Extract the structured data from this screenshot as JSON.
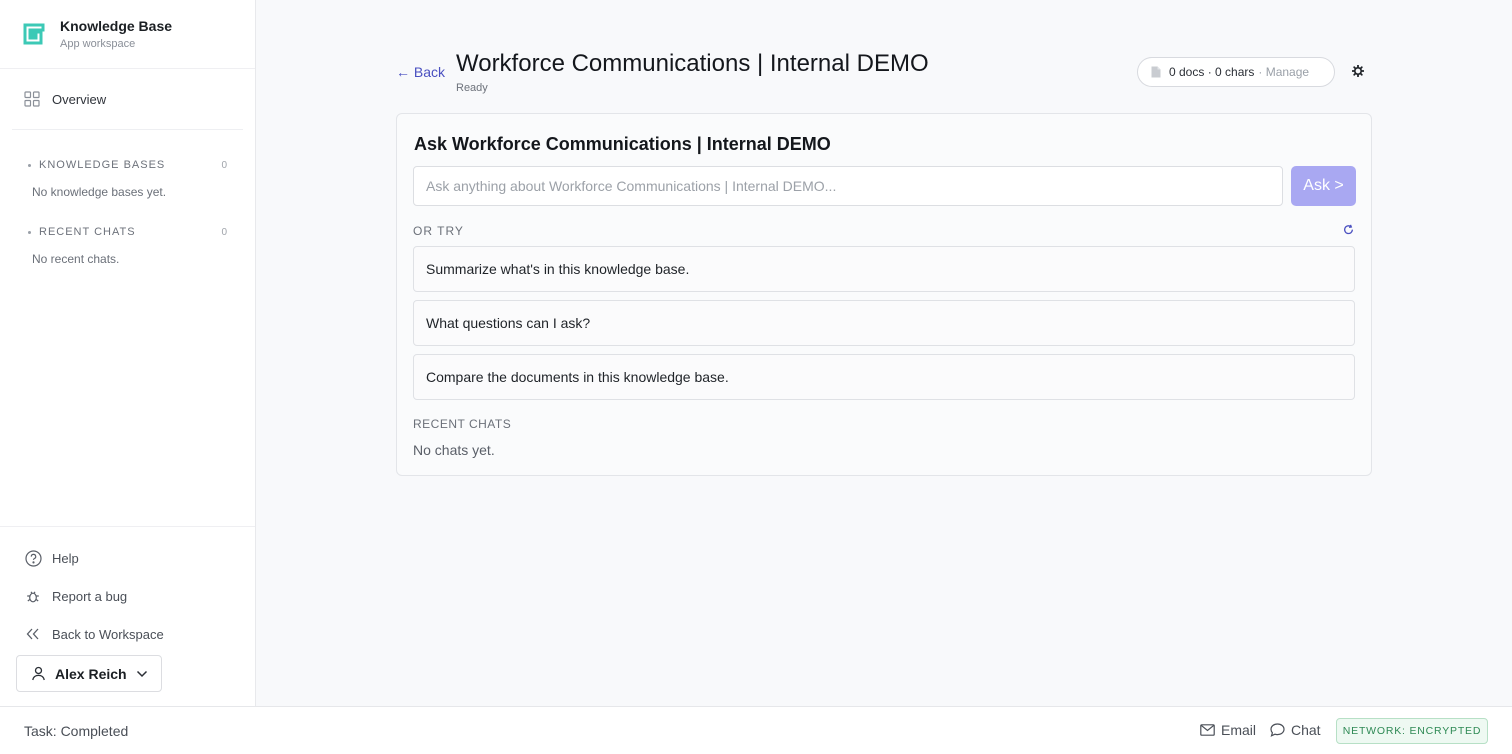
{
  "sidebar": {
    "brand_title": "Knowledge Base",
    "brand_subtitle": "App workspace",
    "overview_label": "Overview",
    "knowledge_bases": {
      "label": "KNOWLEDGE BASES",
      "count": "0",
      "empty": "No knowledge bases yet."
    },
    "recent_chats": {
      "label": "RECENT CHATS",
      "count": "0",
      "empty": "No recent chats."
    },
    "help_label": "Help",
    "bug_label": "Report a bug",
    "back_workspace_label": "Back to Workspace",
    "user_name": "Alex Reich"
  },
  "main": {
    "back_label": "← Back",
    "title": "Workforce Communications | Internal DEMO",
    "status": "Ready",
    "docs_summary": "0 docs · 0 chars",
    "manage_label": "· Manage",
    "card_title": "Ask Workforce Communications | Internal DEMO",
    "ask_placeholder": "Ask anything about Workforce Communications | Internal DEMO...",
    "ask_button": "Ask >",
    "or_try_label": "OR TRY",
    "suggestions": [
      "Summarize what's in this knowledge base.",
      "What questions can I ask?",
      "Compare the documents in this knowledge base."
    ],
    "recent_chats_label": "RECENT CHATS",
    "recent_chats_empty": "No chats yet."
  },
  "footer": {
    "task_status": "Task: Completed",
    "email_label": "Email",
    "chat_label": "Chat",
    "network_label": "NETWORK: ENCRYPTED"
  },
  "colors": {
    "accent": "#4a50c0",
    "ask_button": "#a9a8f2",
    "brand_logo": "#3cc9b6",
    "network_badge": "#2f8a55"
  }
}
